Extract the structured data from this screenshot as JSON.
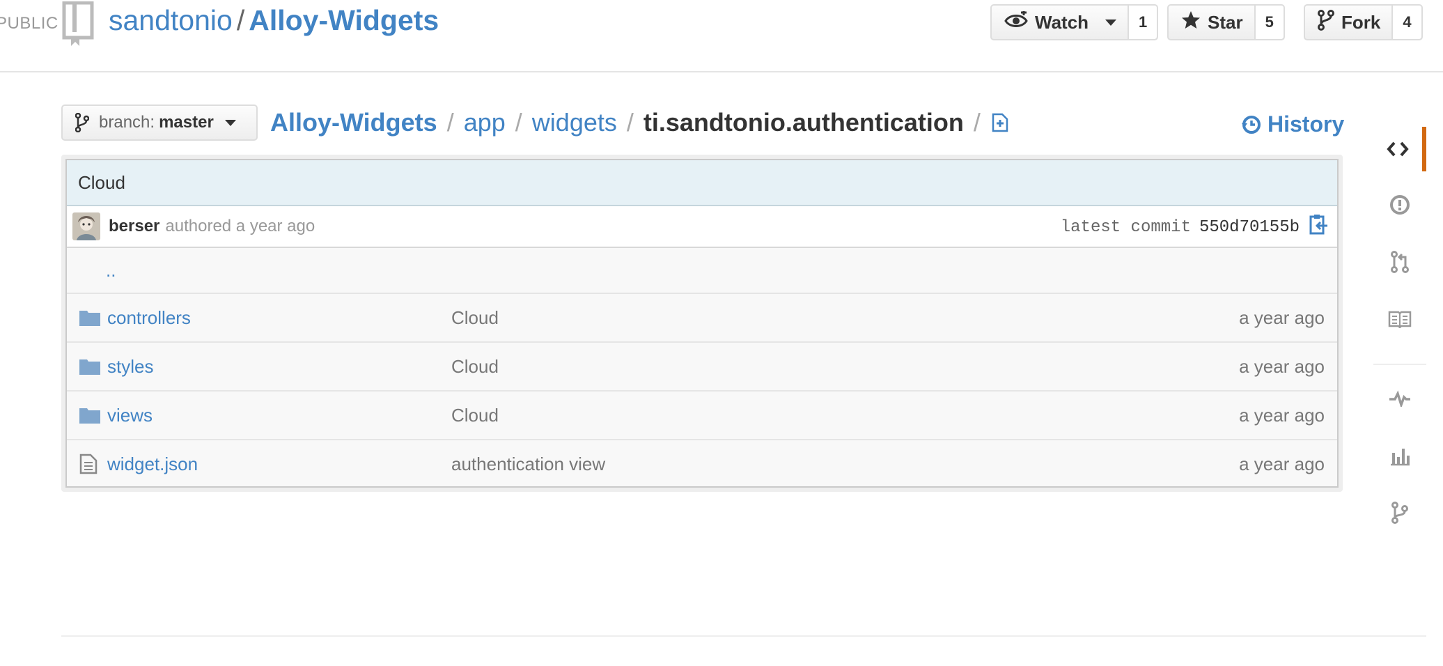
{
  "header": {
    "public_label": "PUBLIC",
    "owner": "sandtonio",
    "separator": "/",
    "repo": "Alloy-Widgets",
    "watch": {
      "label": "Watch",
      "count": "1"
    },
    "star": {
      "label": "Star",
      "count": "5"
    },
    "fork": {
      "label": "Fork",
      "count": "4"
    }
  },
  "branch": {
    "prefix": "branch:",
    "name": "master"
  },
  "breadcrumb": {
    "root": "Alloy-Widgets",
    "parts": [
      "app",
      "widgets"
    ],
    "current": "ti.sandtonio.authentication",
    "slash": "/"
  },
  "history_label": "History",
  "commit": {
    "message": "Cloud",
    "author": "berser",
    "authored_text": "authored a year ago",
    "latest_label": "latest commit",
    "sha": "550d70155b"
  },
  "up_dir": "..",
  "files": [
    {
      "type": "dir",
      "name": "controllers",
      "message": "Cloud",
      "age": "a year ago"
    },
    {
      "type": "dir",
      "name": "styles",
      "message": "Cloud",
      "age": "a year ago"
    },
    {
      "type": "dir",
      "name": "views",
      "message": "Cloud",
      "age": "a year ago"
    },
    {
      "type": "file",
      "name": "widget.json",
      "message": "authentication view",
      "age": "a year ago"
    }
  ],
  "colors": {
    "link": "#4183c4",
    "accent": "#d26911",
    "commit_bg": "#e6f1f6"
  },
  "sidenav_icons": [
    "code-icon",
    "issues-icon",
    "pull-requests-icon",
    "wiki-icon",
    "pulse-icon",
    "graphs-icon",
    "network-icon"
  ]
}
